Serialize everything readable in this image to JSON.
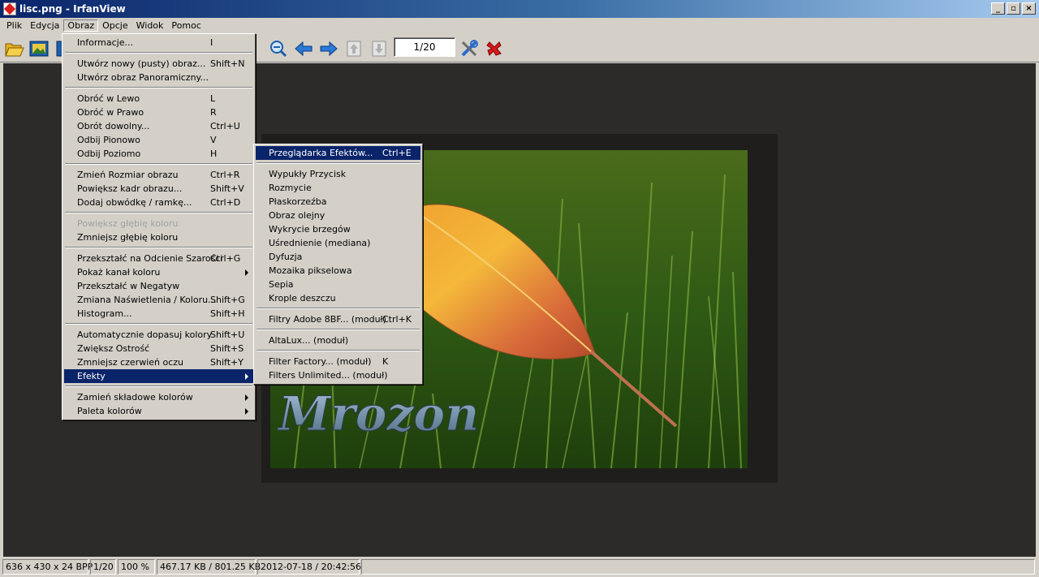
{
  "window": {
    "title": "lisc.png - IrfanView",
    "controls": [
      "_",
      "▫",
      "×"
    ]
  },
  "menubar": [
    "Plik",
    "Edycja",
    "Obraz",
    "Opcje",
    "Widok",
    "Pomoc"
  ],
  "toolbar": {
    "page_indicator": "1/20"
  },
  "obraz_menu": [
    {
      "label": "Informacje...",
      "shortcut": "I"
    },
    {
      "sep": true
    },
    {
      "label": "Utwórz nowy (pusty) obraz...",
      "shortcut": "Shift+N"
    },
    {
      "label": "Utwórz obraz Panoramiczny...",
      "shortcut": ""
    },
    {
      "sep": true
    },
    {
      "label": "Obróć w Lewo",
      "shortcut": "L"
    },
    {
      "label": "Obróć w Prawo",
      "shortcut": "R"
    },
    {
      "label": "Obrót dowolny...",
      "shortcut": "Ctrl+U"
    },
    {
      "label": "Odbij Pionowo",
      "shortcut": "V"
    },
    {
      "label": "Odbij Poziomo",
      "shortcut": "H"
    },
    {
      "sep": true
    },
    {
      "label": "Zmień Rozmiar obrazu",
      "shortcut": "Ctrl+R"
    },
    {
      "label": "Powiększ kadr obrazu...",
      "shortcut": "Shift+V"
    },
    {
      "label": "Dodaj obwódkę / ramkę...",
      "shortcut": "Ctrl+D"
    },
    {
      "sep": true
    },
    {
      "label": "Powiększ głębię koloru",
      "shortcut": "",
      "disabled": true
    },
    {
      "label": "Zmniejsz głębię koloru",
      "shortcut": ""
    },
    {
      "sep": true
    },
    {
      "label": "Przekształć na Odcienie Szarości",
      "shortcut": "Ctrl+G"
    },
    {
      "label": "Pokaż kanał koloru",
      "shortcut": "",
      "submenu": true
    },
    {
      "label": "Przekształć w Negatyw",
      "shortcut": ""
    },
    {
      "label": "Zmiana Naświetlenia / Koloru...",
      "shortcut": "Shift+G"
    },
    {
      "label": "Histogram...",
      "shortcut": "Shift+H"
    },
    {
      "sep": true
    },
    {
      "label": "Automatycznie dopasuj kolory",
      "shortcut": "Shift+U"
    },
    {
      "label": "Zwiększ Ostrość",
      "shortcut": "Shift+S"
    },
    {
      "label": "Zmniejsz czerwień oczu",
      "shortcut": "Shift+Y"
    },
    {
      "label": "Efekty",
      "shortcut": "",
      "submenu": true,
      "highlighted": true
    },
    {
      "sep": true
    },
    {
      "label": "Zamień składowe kolorów",
      "shortcut": "",
      "submenu": true
    },
    {
      "label": "Paleta kolorów",
      "shortcut": "",
      "submenu": true
    }
  ],
  "efekty_menu": [
    {
      "label": "Przeglądarka Efektów...",
      "shortcut": "Ctrl+E",
      "highlighted": true
    },
    {
      "sep": true
    },
    {
      "label": "Wypukły Przycisk",
      "shortcut": ""
    },
    {
      "label": "Rozmycie",
      "shortcut": ""
    },
    {
      "label": "Płaskorzeźba",
      "shortcut": ""
    },
    {
      "label": "Obraz olejny",
      "shortcut": ""
    },
    {
      "label": "Wykrycie brzegów",
      "shortcut": ""
    },
    {
      "label": "Uśrednienie (mediana)",
      "shortcut": ""
    },
    {
      "label": "Dyfuzja",
      "shortcut": ""
    },
    {
      "label": "Mozaika pikselowa",
      "shortcut": ""
    },
    {
      "label": "Sepia",
      "shortcut": ""
    },
    {
      "label": "Krople deszczu",
      "shortcut": ""
    },
    {
      "sep": true
    },
    {
      "label": "Filtry Adobe 8BF... (moduł)",
      "shortcut": "Ctrl+K"
    },
    {
      "sep": true
    },
    {
      "label": "AltaLux... (moduł)",
      "shortcut": ""
    },
    {
      "sep": true
    },
    {
      "label": "Filter Factory... (moduł)",
      "shortcut": "K"
    },
    {
      "label": "Filters Unlimited... (moduł)",
      "shortcut": ""
    }
  ],
  "image": {
    "watermark": "Mrozon"
  },
  "statusbar": {
    "dimensions": "636 x 430 x 24 BPP",
    "page": "1/20",
    "zoom": "100 %",
    "size": "467.17 KB / 801.25 KB",
    "datetime": "2012-07-18 / 20:42:56"
  },
  "colors": {
    "titlebar": "#0a246a",
    "highlight": "#0a246a",
    "viewport": "#2c2b29"
  }
}
